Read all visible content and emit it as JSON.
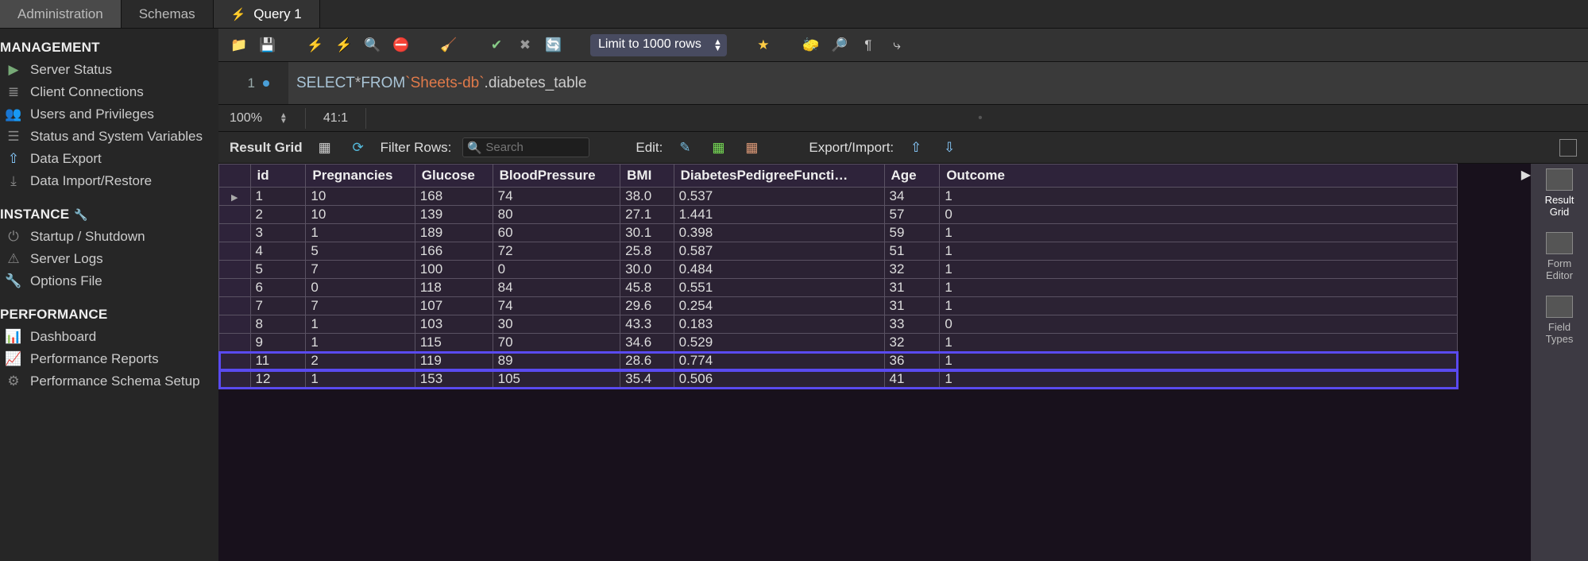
{
  "tabs": {
    "admin": "Administration",
    "schemas": "Schemas",
    "query": "Query 1"
  },
  "sidebar": {
    "management_title": "MANAGEMENT",
    "management": {
      "server_status": "Server Status",
      "client_connections": "Client Connections",
      "users": "Users and Privileges",
      "status_vars": "Status and System Variables",
      "data_export": "Data Export",
      "data_import": "Data Import/Restore"
    },
    "instance_title": "INSTANCE",
    "instance": {
      "startup": "Startup / Shutdown",
      "server_logs": "Server Logs",
      "options": "Options File"
    },
    "performance_title": "PERFORMANCE",
    "performance": {
      "dashboard": "Dashboard",
      "reports": "Performance Reports",
      "schema_setup": "Performance Schema Setup"
    }
  },
  "toolbar": {
    "limit_label": "Limit to 1000 rows"
  },
  "editor": {
    "line_no": "1",
    "kw_select": "SELECT",
    "star": " * ",
    "kw_from": "FROM",
    "sp": " ",
    "tick1": "`",
    "db": "Sheets-db",
    "tick2": "`",
    "tail": ".diabetes_table"
  },
  "status": {
    "zoom": "100%",
    "cursor": "41:1"
  },
  "result_toolbar": {
    "result_grid": "Result Grid",
    "filter_rows": "Filter Rows:",
    "search_placeholder": "Search",
    "edit": "Edit:",
    "export_import": "Export/Import:"
  },
  "right_strip": {
    "result_grid": "Result\nGrid",
    "form_editor": "Form\nEditor",
    "field_types": "Field\nTypes"
  },
  "columns": [
    "id",
    "Pregnancies",
    "Glucose",
    "BloodPressure",
    "BMI",
    "DiabetesPedigreeFuncti…",
    "Age",
    "Outcome"
  ],
  "rows": [
    {
      "id": "1",
      "Pregnancies": "10",
      "Glucose": "168",
      "BloodPressure": "74",
      "BMI": "38.0",
      "DPF": "0.537",
      "Age": "34",
      "Outcome": "1"
    },
    {
      "id": "2",
      "Pregnancies": "10",
      "Glucose": "139",
      "BloodPressure": "80",
      "BMI": "27.1",
      "DPF": "1.441",
      "Age": "57",
      "Outcome": "0"
    },
    {
      "id": "3",
      "Pregnancies": "1",
      "Glucose": "189",
      "BloodPressure": "60",
      "BMI": "30.1",
      "DPF": "0.398",
      "Age": "59",
      "Outcome": "1"
    },
    {
      "id": "4",
      "Pregnancies": "5",
      "Glucose": "166",
      "BloodPressure": "72",
      "BMI": "25.8",
      "DPF": "0.587",
      "Age": "51",
      "Outcome": "1"
    },
    {
      "id": "5",
      "Pregnancies": "7",
      "Glucose": "100",
      "BloodPressure": "0",
      "BMI": "30.0",
      "DPF": "0.484",
      "Age": "32",
      "Outcome": "1"
    },
    {
      "id": "6",
      "Pregnancies": "0",
      "Glucose": "118",
      "BloodPressure": "84",
      "BMI": "45.8",
      "DPF": "0.551",
      "Age": "31",
      "Outcome": "1"
    },
    {
      "id": "7",
      "Pregnancies": "7",
      "Glucose": "107",
      "BloodPressure": "74",
      "BMI": "29.6",
      "DPF": "0.254",
      "Age": "31",
      "Outcome": "1"
    },
    {
      "id": "8",
      "Pregnancies": "1",
      "Glucose": "103",
      "BloodPressure": "30",
      "BMI": "43.3",
      "DPF": "0.183",
      "Age": "33",
      "Outcome": "0"
    },
    {
      "id": "9",
      "Pregnancies": "1",
      "Glucose": "115",
      "BloodPressure": "70",
      "BMI": "34.6",
      "DPF": "0.529",
      "Age": "32",
      "Outcome": "1"
    },
    {
      "id": "11",
      "Pregnancies": "2",
      "Glucose": "119",
      "BloodPressure": "89",
      "BMI": "28.6",
      "DPF": "0.774",
      "Age": "36",
      "Outcome": "1"
    },
    {
      "id": "12",
      "Pregnancies": "1",
      "Glucose": "153",
      "BloodPressure": "105",
      "BMI": "35.4",
      "DPF": "0.506",
      "Age": "41",
      "Outcome": "1"
    }
  ],
  "highlight_rows": [
    9,
    10
  ],
  "col_widths": [
    "34px",
    "60px",
    "100px",
    "72px",
    "110px",
    "58px",
    "188px",
    "60px",
    "560px"
  ]
}
